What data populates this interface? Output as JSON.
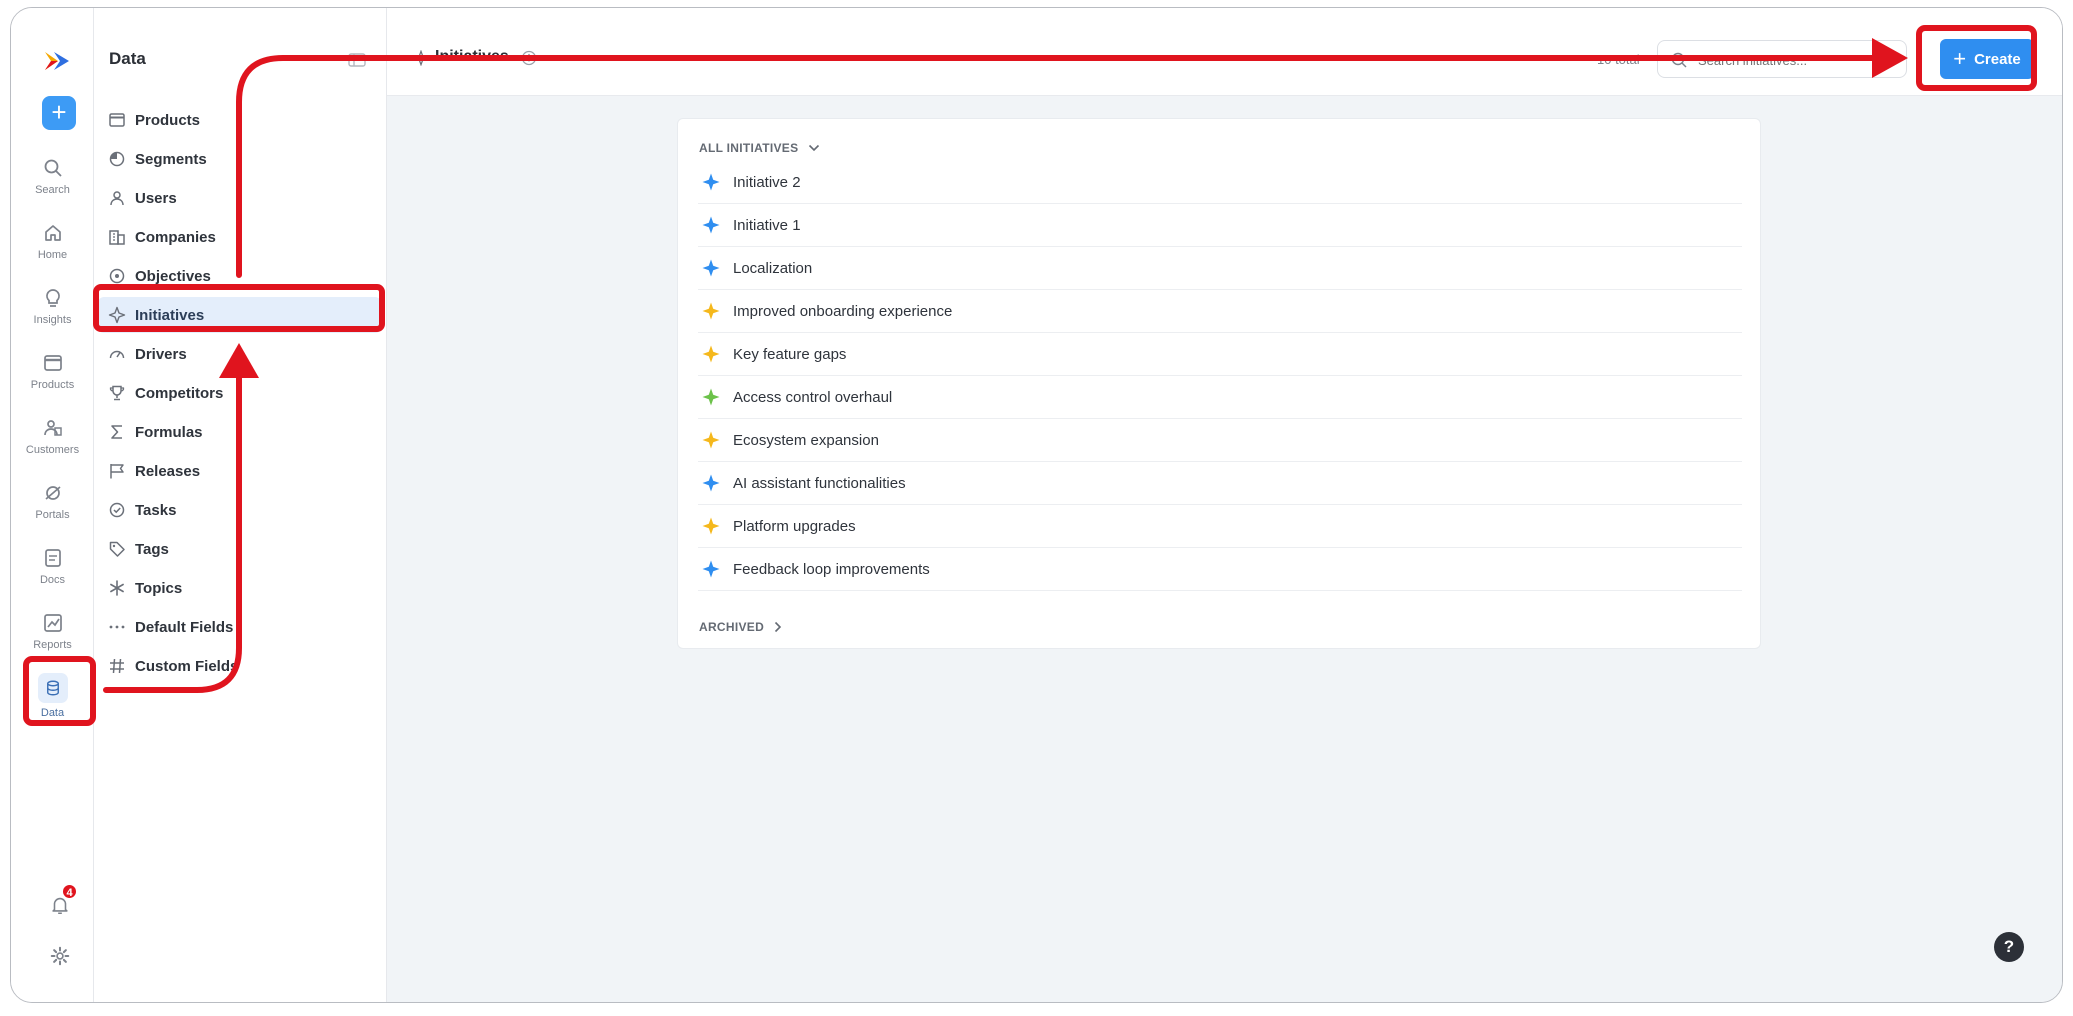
{
  "rail": {
    "plus_symbol": "+",
    "items": [
      {
        "label": "Search",
        "icon": "search-icon"
      },
      {
        "label": "Home",
        "icon": "home-icon"
      },
      {
        "label": "Insights",
        "icon": "lightbulb-icon"
      },
      {
        "label": "Products",
        "icon": "window-icon"
      },
      {
        "label": "Customers",
        "icon": "people-icon"
      },
      {
        "label": "Portals",
        "icon": "portal-icon"
      },
      {
        "label": "Docs",
        "icon": "document-icon"
      },
      {
        "label": "Reports",
        "icon": "chart-icon"
      },
      {
        "label": "Data",
        "icon": "database-icon"
      }
    ],
    "notification_count": "4"
  },
  "sidebar": {
    "title": "Data",
    "items": [
      {
        "label": "Products"
      },
      {
        "label": "Segments"
      },
      {
        "label": "Users"
      },
      {
        "label": "Companies"
      },
      {
        "label": "Objectives"
      },
      {
        "label": "Initiatives"
      },
      {
        "label": "Drivers"
      },
      {
        "label": "Competitors"
      },
      {
        "label": "Formulas"
      },
      {
        "label": "Releases"
      },
      {
        "label": "Tasks"
      },
      {
        "label": "Tags"
      },
      {
        "label": "Topics"
      },
      {
        "label": "Default Fields"
      },
      {
        "label": "Custom Fields"
      }
    ]
  },
  "header": {
    "title": "Initiatives",
    "total": "10 total",
    "search_placeholder": "Search initiatives...",
    "create_label": "Create",
    "create_symbol": "+"
  },
  "list": {
    "group_label": "ALL INITIATIVES",
    "items": [
      {
        "name": "Initiative 2",
        "color": "#2f8ef0"
      },
      {
        "name": "Initiative 1",
        "color": "#2f8ef0"
      },
      {
        "name": "Localization",
        "color": "#2f8ef0"
      },
      {
        "name": "Improved onboarding experience",
        "color": "#f5b81c"
      },
      {
        "name": "Key feature gaps",
        "color": "#f5b81c"
      },
      {
        "name": "Access control overhaul",
        "color": "#6cc24a"
      },
      {
        "name": "Ecosystem expansion",
        "color": "#f5b81c"
      },
      {
        "name": "AI assistant functionalities",
        "color": "#2f8ef0"
      },
      {
        "name": "Platform upgrades",
        "color": "#f5b81c"
      },
      {
        "name": "Feedback loop improvements",
        "color": "#2f8ef0"
      }
    ],
    "archived_label": "ARCHIVED"
  },
  "help_symbol": "?",
  "colors": {
    "accent": "#2f8ef0",
    "annotation": "#e0141e"
  }
}
